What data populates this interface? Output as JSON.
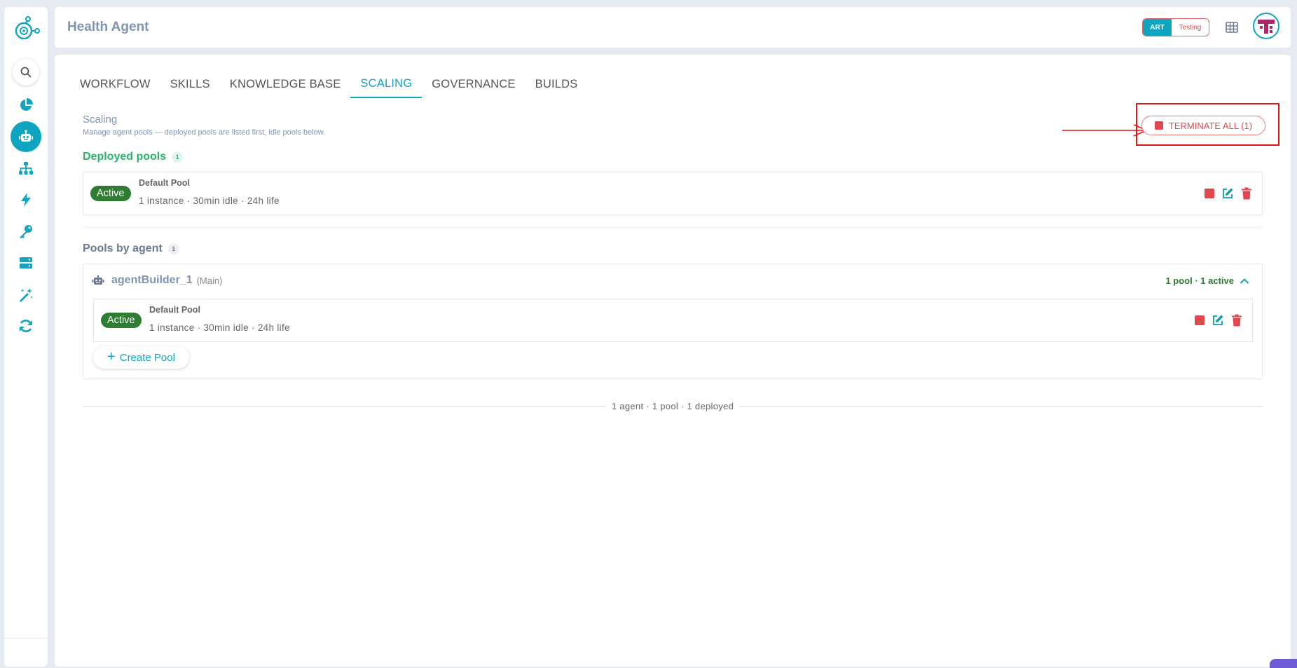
{
  "header": {
    "title": "Health Agent",
    "env_active": "ART",
    "env_other": "Testing"
  },
  "sidebar": {
    "items": [
      "analytics",
      "agents",
      "hierarchy",
      "triggers",
      "keys",
      "servers",
      "magic",
      "sync"
    ],
    "active": "agents"
  },
  "tabs": [
    {
      "label": "WORKFLOW",
      "active": false
    },
    {
      "label": "SKILLS",
      "active": false
    },
    {
      "label": "KNOWLEDGE BASE",
      "active": false
    },
    {
      "label": "SCALING",
      "active": true
    },
    {
      "label": "GOVERNANCE",
      "active": false
    },
    {
      "label": "BUILDS",
      "active": false
    }
  ],
  "scaling": {
    "title": "Scaling",
    "subtitle": "Manage agent pools — deployed pools are listed first, idle pools below.",
    "terminate_label": "TERMINATE ALL (1)"
  },
  "deployed": {
    "title": "Deployed pools",
    "count": "1",
    "pool": {
      "status": "Active",
      "name": "Default Pool",
      "meta": "1 instance · 30min idle · 24h life"
    }
  },
  "by_agent": {
    "title": "Pools by agent",
    "count": "1",
    "agent": {
      "name": "agentBuilder_1",
      "tag": "(Main)",
      "status": "1 pool · 1 active",
      "pool": {
        "status": "Active",
        "name": "Default Pool",
        "meta": "1 instance · 30min idle · 24h life"
      },
      "create_label": "Create Pool"
    }
  },
  "footer": {
    "summary": "1 agent · 1 pool · 1 deployed"
  },
  "colors": {
    "accent": "#0fa5c0",
    "danger": "#e0474f",
    "success": "#2e7d32",
    "deployed_green": "#29b46c"
  }
}
